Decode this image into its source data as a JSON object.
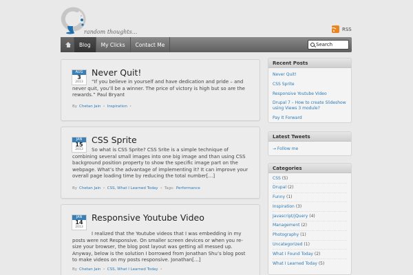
{
  "header": {
    "tagline": "random thoughts...",
    "rss_label": "RSS"
  },
  "nav": {
    "items": [
      {
        "label": "Blog"
      },
      {
        "label": "My Clicks"
      },
      {
        "label": "Contact Me"
      }
    ],
    "search_placeholder": "Search"
  },
  "posts": [
    {
      "month": "AUG",
      "day": "3",
      "year": "2013",
      "title": "Never Quit!",
      "excerpt": "“If you believe in yourself and have dedication and pride – and never quit, you’ll be a winner. The price of victory is high but so are the rewards.” Paul Bryant",
      "by": "By",
      "author": "Chetan Jain",
      "categories": "Inspiration",
      "tags_label": "",
      "tags": ""
    },
    {
      "month": "JAN",
      "day": "15",
      "year": "2013",
      "title": "CSS Sprite",
      "excerpt": "So what is CSS Sprite? CSS Srite is a simple technique of combining several small images into one big image and than using CSS background position property to show the specific image part on the webpage. What’s the advantage of implementing it? It can improve your overall page loading time by reducing the total number[…]",
      "by": "By",
      "author": "Chetan Jain",
      "categories": "CSS, What I Learned Today",
      "tags_label": "Tags:",
      "tags": "Performance"
    },
    {
      "month": "JAN",
      "day": "14",
      "year": "2013",
      "title": "Responsive Youtube Video",
      "excerpt": "I realized that the Youtube videos that I was embedding in my posts were not Responsive. On smaller screen devices or when you re-size your browser, the blog post layout was getting all messed up. Anyway, below is the solution I borrowed from Jonathan Shu’s blog post to make videos on my posts responsive. Jonathan[…]",
      "by": "By",
      "author": "Chetan Jain",
      "categories": "CSS, What I Learned Today",
      "tags_label": "",
      "tags": ""
    }
  ],
  "sidebar": {
    "recent_posts": {
      "title": "Recent Posts",
      "items": [
        "Never Quit!",
        "CSS Sprite",
        "Responsive Youtube Video",
        "Drupal 7 – How to create Slideshow using Views 3 module?",
        "Pay It Forward"
      ]
    },
    "latest_tweets": {
      "title": "Latest Tweets",
      "follow": "→ Follow me"
    },
    "categories": {
      "title": "Categories",
      "items": [
        {
          "name": "CSS",
          "count": "(5)"
        },
        {
          "name": "Drupal",
          "count": "(2)"
        },
        {
          "name": "Funny",
          "count": "(1)"
        },
        {
          "name": "Inspiration",
          "count": "(3)"
        },
        {
          "name": "Javascript/jQuery",
          "count": "(4)"
        },
        {
          "name": "Management",
          "count": "(2)"
        },
        {
          "name": "Photography",
          "count": "(1)"
        },
        {
          "name": "Uncategorized",
          "count": "(1)"
        },
        {
          "name": "What I Found Today",
          "count": "(2)"
        },
        {
          "name": "What I Learned Today",
          "count": "(5)"
        }
      ]
    }
  },
  "colors": {
    "link": "#2c79b5",
    "date_month_bg": "#3a7fb5",
    "nav_bg": "#6e6e6e",
    "rss": "#e98524"
  }
}
